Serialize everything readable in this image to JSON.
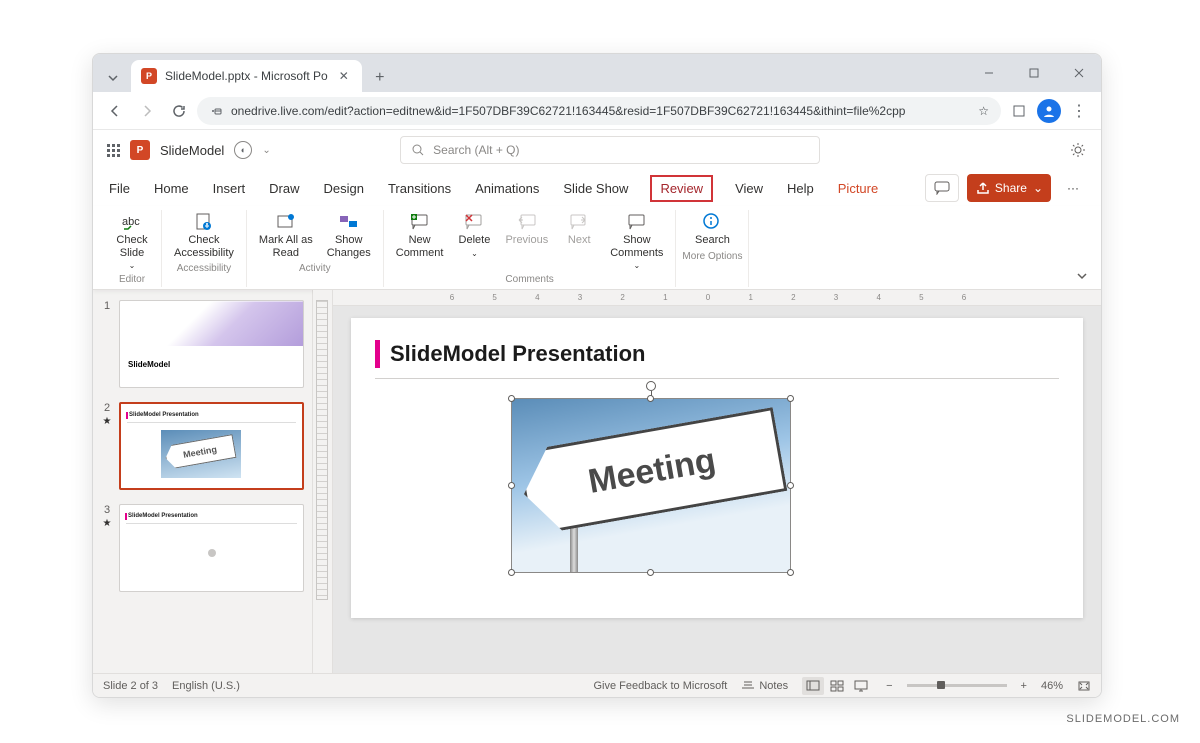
{
  "browser": {
    "tab_title": "SlideModel.pptx - Microsoft Po",
    "url": "onedrive.live.com/edit?action=editnew&id=1F507DBF39C62721!163445&resid=1F507DBF39C62721!163445&ithint=file%2cpp"
  },
  "header": {
    "doc_name": "SlideModel",
    "search_placeholder": "Search (Alt + Q)"
  },
  "ribbon_tabs": {
    "file": "File",
    "home": "Home",
    "insert": "Insert",
    "draw": "Draw",
    "design": "Design",
    "transitions": "Transitions",
    "animations": "Animations",
    "slideshow": "Slide Show",
    "review": "Review",
    "view": "View",
    "help": "Help",
    "picture": "Picture",
    "share": "Share"
  },
  "ribbon": {
    "editor": {
      "check_slide": "Check\nSlide",
      "label": "Editor"
    },
    "accessibility": {
      "check": "Check\nAccessibility",
      "label": "Accessibility"
    },
    "activity": {
      "mark_read": "Mark All as\nRead",
      "show_changes": "Show\nChanges",
      "label": "Activity"
    },
    "comments": {
      "new": "New\nComment",
      "delete": "Delete",
      "previous": "Previous",
      "next": "Next",
      "show": "Show\nComments",
      "label": "Comments"
    },
    "more": {
      "search": "Search",
      "label": "More Options"
    }
  },
  "thumbs": {
    "n1": "1",
    "n2": "2",
    "n3": "3",
    "t1_title": "SlideModel",
    "t2_title": "SlideModel Presentation",
    "t3_title": "SlideModel Presentation",
    "sign": "Meeting"
  },
  "slide": {
    "title": "SlideModel Presentation",
    "sign_text": "Meeting"
  },
  "ruler": "6 5 4 3 2 1 0 1 2 3 4 5 6",
  "status": {
    "slide": "Slide 2 of 3",
    "lang": "English (U.S.)",
    "feedback": "Give Feedback to Microsoft",
    "notes": "Notes",
    "zoom": "46%"
  },
  "watermark": "SLIDEMODEL.COM"
}
